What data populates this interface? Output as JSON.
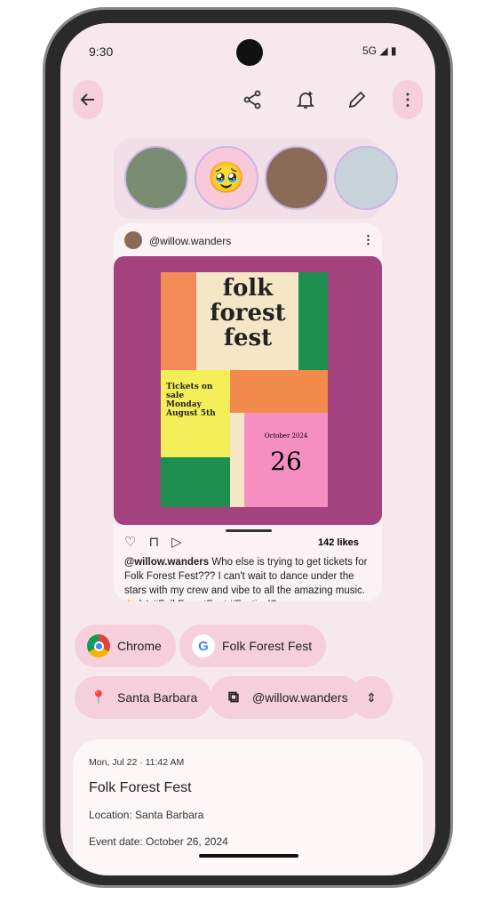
{
  "status": {
    "time": "9:30",
    "network": "5G"
  },
  "toolbar": {
    "icons": [
      "back-arrow",
      "share",
      "add-reminder",
      "edit",
      "more-vertical"
    ]
  },
  "post": {
    "username": "@willow.wanders",
    "likes": "142 likes",
    "caption_user": "@willow.wanders",
    "caption": " Who else is trying to get tickets for Folk Forest Fest??? I can't wait to dance under the stars with my crew and vibe to all the amazing music. ✨🎶 #FolkForestFest #FestivalSeason #DreamComeTrue",
    "poster": {
      "title1": "folk",
      "title2": "forest",
      "title3": "fest",
      "tickets": "Tickets on sale Monday August 5th",
      "month": "October 2024",
      "day": "26"
    }
  },
  "chips": [
    {
      "label": "Chrome",
      "icon": "chrome-logo"
    },
    {
      "label": "Folk Forest Fest",
      "icon": "google-logo"
    },
    {
      "label": "Santa Barbara",
      "icon": "maps-pin"
    },
    {
      "label": "@willow.wanders",
      "icon": "copy"
    }
  ],
  "info": {
    "timestamp": "Mon, Jul 22 · 11:42 AM",
    "title": "Folk Forest Fest",
    "location": "Location: Santa Barbara",
    "event_date": "Event date: October 26, 2024"
  },
  "colors": {
    "background": "#f7e8ed",
    "chip": "#f5cfdc",
    "poster_bg": "#a4427f"
  }
}
